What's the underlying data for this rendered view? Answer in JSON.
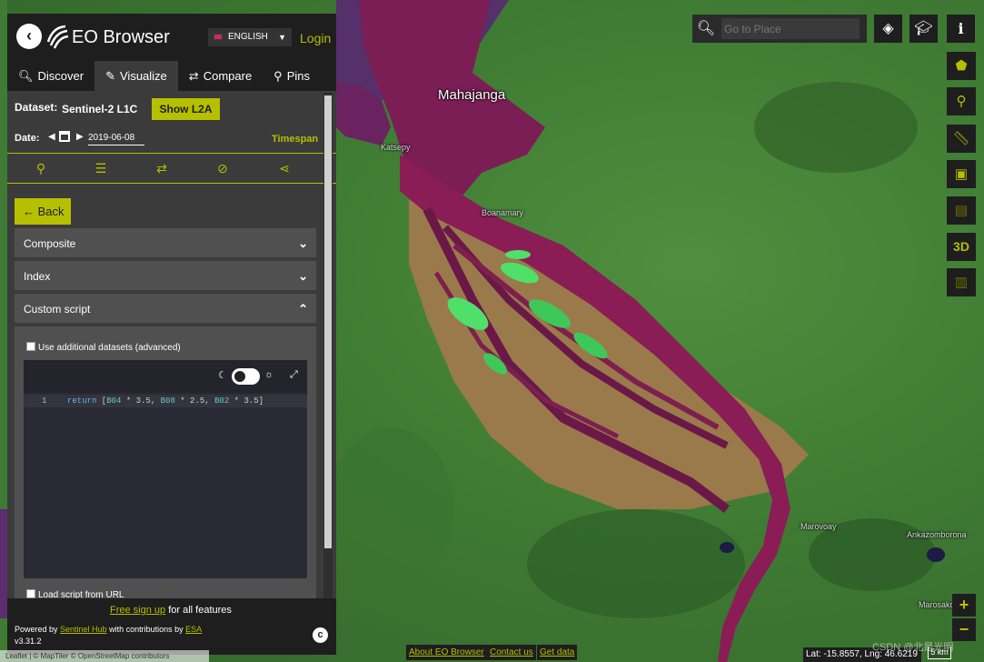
{
  "app": {
    "title": "EO Browser",
    "language": "ENGLISH",
    "login_label": "Login"
  },
  "tabs": [
    {
      "label": "Discover",
      "icon": "search-icon"
    },
    {
      "label": "Visualize",
      "icon": "brush-icon"
    },
    {
      "label": "Compare",
      "icon": "compare-icon"
    },
    {
      "label": "Pins",
      "icon": "pin-icon"
    }
  ],
  "dataset": {
    "label": "Dataset:",
    "value": "Sentinel-2 L1C",
    "show_l2a_label": "Show L2A"
  },
  "date": {
    "label": "Date:",
    "value": "2019-06-08",
    "timespan_label": "Timespan"
  },
  "tools": [
    "pin-icon",
    "sliders-icon",
    "compare-icon",
    "hide-icon",
    "share-icon"
  ],
  "back_label": "Back",
  "accordions": [
    {
      "label": "Composite",
      "expanded": false
    },
    {
      "label": "Index",
      "expanded": false
    },
    {
      "label": "Custom script",
      "expanded": true
    }
  ],
  "custom_script": {
    "additional_datasets_label": "Use additional datasets (advanced)",
    "line_number": "1",
    "code_keyword": "return",
    "code_b04": "B04",
    "code_b08": "B08",
    "code_b02": "B02",
    "code_f1": " * 3.5, ",
    "code_f2": " * 2.5, ",
    "code_f3": " * 3.5]",
    "load_url_label": "Load script from URL"
  },
  "footer": {
    "signup_link": "Free sign up",
    "signup_rest": " for all features",
    "powered_prefix": "Powered by ",
    "sentinel_hub_link": "Sentinel Hub",
    "powered_mid": " with contributions by ",
    "esa_link": "ESA",
    "version": "v3.31.2"
  },
  "search": {
    "placeholder": "Go to Place"
  },
  "right_toolbar": {
    "three_d_label": "3D"
  },
  "map": {
    "labels": {
      "mahajanga": "Mahajanga",
      "katsepy": "Katsepy",
      "boanamary": "Boanamary",
      "marovoay": "Marovoay",
      "ankazomborona": "Ankazomborona",
      "marosakoa": "Marosako"
    }
  },
  "bottom": {
    "attribution": "Leaflet | © MapTiler © OpenStreetMap contributors",
    "about_link": "About EO Browser",
    "contact_link": "Contact us",
    "data_link": "Get data",
    "coordinates": "Lat: -15.8557, Lng: 46.6219",
    "scale": "5 km",
    "watermark": "CSDN @北是光明"
  },
  "colors": {
    "accent": "#b6bf00",
    "panel_bg": "#3b3b3b",
    "header_bg": "#1e1e1e"
  }
}
